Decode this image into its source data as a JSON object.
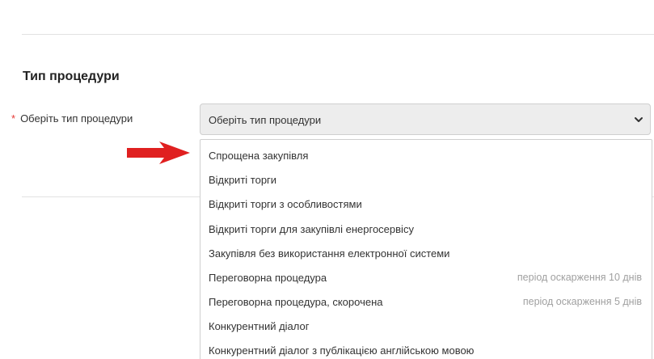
{
  "section": {
    "title": "Тип процедури"
  },
  "field": {
    "required_mark": "*",
    "label": "Оберіть тип процедури"
  },
  "select": {
    "selected_value": "Оберіть тип процедури",
    "icon": "chevron-down-icon"
  },
  "annotation": {
    "icon": "red-arrow-right-icon",
    "color": "#e02020"
  },
  "options": [
    {
      "label": "Спрощена закупівля",
      "note": ""
    },
    {
      "label": "Відкриті торги",
      "note": ""
    },
    {
      "label": "Відкриті торги з особливостями",
      "note": ""
    },
    {
      "label": "Відкриті торги для закупівлі енергосервісу",
      "note": ""
    },
    {
      "label": "Закупівля без використання електронної системи",
      "note": ""
    },
    {
      "label": "Переговорна процедура",
      "note": "період оскарження 10 днів"
    },
    {
      "label": "Переговорна процедура, скорочена",
      "note": "період оскарження 5 днів"
    },
    {
      "label": "Конкурентний діалог",
      "note": ""
    },
    {
      "label": "Конкурентний діалог з публікацією англійською мовою",
      "note": ""
    }
  ]
}
